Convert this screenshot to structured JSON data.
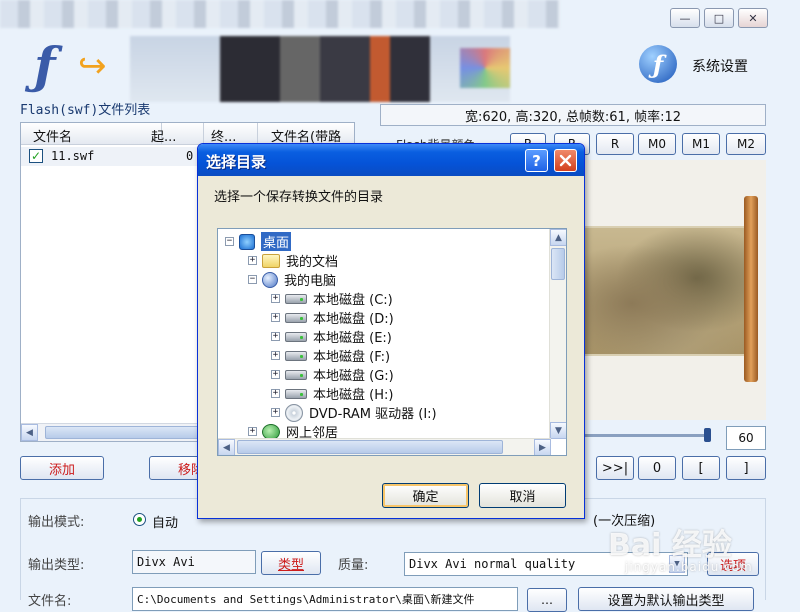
{
  "window": {
    "minimize_glyph": "—",
    "maximize_glyph": "□",
    "close_glyph": "✕",
    "settings_label": "系统设置"
  },
  "file_list": {
    "title": "Flash(swf)文件列表",
    "columns": [
      "文件名",
      "起...",
      "终...",
      "文件名(带路径"
    ],
    "rows": [
      {
        "checked": true,
        "name": "11.swf",
        "start": "0"
      }
    ]
  },
  "info_bar": "宽:620, 高:320, 总帧数:61, 帧率:12",
  "bg_color_label": "Flash背景颜色",
  "mode_buttons": [
    "R",
    "R",
    "R",
    "M0",
    "M1",
    "M2"
  ],
  "frame_value": "60",
  "left_buttons": {
    "add": "添加",
    "remove": "移除"
  },
  "playback_buttons": [
    ">>|",
    "0",
    "[",
    "]"
  ],
  "output": {
    "mode_label": "输出模式:",
    "mode_auto": "自动",
    "compress_hint": "(一次压缩)",
    "type_label": "输出类型:",
    "type_value": "Divx Avi",
    "type_button": "类型",
    "quality_label": "质量:",
    "quality_value": "Divx Avi normal quality",
    "options_button": "选项",
    "file_label": "文件名:",
    "file_value": "C:\\Documents and Settings\\Administrator\\桌面\\新建文件",
    "default_button": "设置为默认输出类型"
  },
  "dialog": {
    "title": "选择目录",
    "help": "?",
    "prompt": "选择一个保存转换文件的目录",
    "tree": [
      {
        "label": "桌面",
        "level": 0,
        "expander": "−",
        "icon": "desktop-icon",
        "selected": true
      },
      {
        "label": "我的文档",
        "level": 1,
        "expander": "+",
        "icon": "folder-icon"
      },
      {
        "label": "我的电脑",
        "level": 1,
        "expander": "−",
        "icon": "computer-icon"
      },
      {
        "label": "本地磁盘 (C:)",
        "level": 2,
        "expander": "+",
        "icon": "drive-icon"
      },
      {
        "label": "本地磁盘 (D:)",
        "level": 2,
        "expander": "+",
        "icon": "drive-icon"
      },
      {
        "label": "本地磁盘 (E:)",
        "level": 2,
        "expander": "+",
        "icon": "drive-icon"
      },
      {
        "label": "本地磁盘 (F:)",
        "level": 2,
        "expander": "+",
        "icon": "drive-icon"
      },
      {
        "label": "本地磁盘 (G:)",
        "level": 2,
        "expander": "+",
        "icon": "drive-icon"
      },
      {
        "label": "本地磁盘 (H:)",
        "level": 2,
        "expander": "+",
        "icon": "drive-icon"
      },
      {
        "label": "DVD-RAM 驱动器 (I:)",
        "level": 2,
        "expander": "+",
        "icon": "dvd-icon"
      },
      {
        "label": "网上邻居",
        "level": 1,
        "expander": "+",
        "icon": "network-icon"
      }
    ],
    "ok": "确定",
    "cancel": "取消"
  },
  "watermark": {
    "brand": "Bai 经验",
    "sub": "jingyan.baidu.com"
  }
}
